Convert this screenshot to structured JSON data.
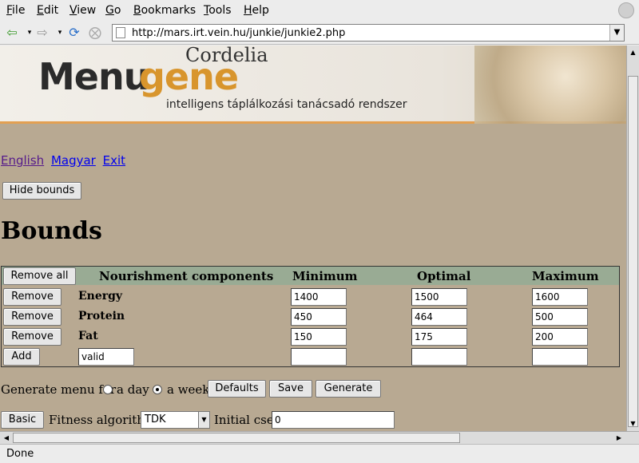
{
  "menubar": {
    "items": [
      "File",
      "Edit",
      "View",
      "Go",
      "Bookmarks",
      "Tools",
      "Help"
    ]
  },
  "navbar": {
    "url": "http://mars.irt.vein.hu/junkie/junkie2.php",
    "back_icon": "back-arrow-icon",
    "forward_icon": "forward-arrow-icon",
    "reload_icon": "reload-icon",
    "stop_icon": "stop-icon"
  },
  "banner": {
    "logo_menu": "Menu",
    "logo_gene": "gene",
    "logo_cordelia": "Cordelia",
    "subtitle": "intelligens táplálkozási tanácsadó rendszer"
  },
  "links": {
    "english": "English",
    "magyar": "Magyar",
    "exit": "Exit"
  },
  "hide_bounds_label": "Hide bounds",
  "page_heading": "Bounds",
  "table": {
    "remove_all_label": "Remove all",
    "headers": {
      "components": "Nourishment components",
      "minimum": "Minimum",
      "optimal": "Optimal",
      "maximum": "Maximum"
    },
    "rows": [
      {
        "remove_label": "Remove",
        "name": "Energy",
        "minimum": "1400",
        "optimal": "1500",
        "maximum": "1600"
      },
      {
        "remove_label": "Remove",
        "name": "Protein",
        "minimum": "450",
        "optimal": "464",
        "maximum": "500"
      },
      {
        "remove_label": "Remove",
        "name": "Fat",
        "minimum": "150",
        "optimal": "175",
        "maximum": "200"
      }
    ],
    "add_label": "Add",
    "add_component_value": "valid",
    "add_minimum": "",
    "add_optimal": "",
    "add_maximum": ""
  },
  "generate": {
    "label": "Generate menu for",
    "option_day": "a day",
    "option_week": "a week",
    "selected": "a week",
    "defaults_label": "Defaults",
    "save_label": "Save",
    "generate_label": "Generate"
  },
  "fitness": {
    "basic_label": "Basic",
    "algorithm_label": "Fitness algorithm:",
    "algorithm_value": "TDK",
    "cset_label": "Initial cset:",
    "cset_value": "0"
  },
  "status": {
    "text": "Done"
  },
  "colors": {
    "page_bg": "#b8a992",
    "table_header_bg": "#99ab94",
    "link": "#0000ee",
    "visited_link": "#551a8b",
    "accent": "#d8952d"
  }
}
